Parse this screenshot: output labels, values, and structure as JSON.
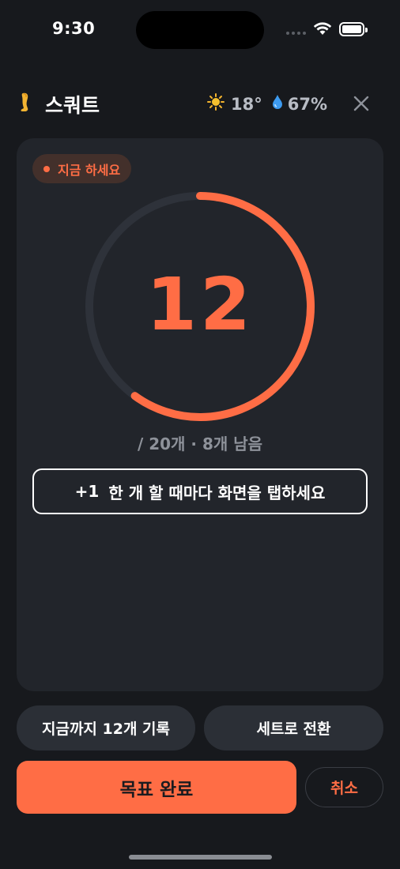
{
  "status_bar": {
    "time": "9:30"
  },
  "header": {
    "icon": "leg-emoji",
    "title": "스쿼트",
    "weather": {
      "icon": "sun-icon",
      "temperature": "18°",
      "humidity_icon": "droplet-icon",
      "humidity": "67%"
    },
    "close_icon": "close-icon"
  },
  "card": {
    "badge": "지금 하세요",
    "count": "12",
    "progress": {
      "current": 12,
      "goal": 20
    },
    "subtitle": "/ 20개 · 8개 남음",
    "tap_button": {
      "prefix": "+1",
      "label": "한 개 할 때마다 화면을 탭하세요"
    }
  },
  "actions": {
    "record_label": "지금까지 12개 기록",
    "switch_label": "세트로 전환",
    "complete_label": "목표 완료",
    "cancel_label": "취소"
  },
  "colors": {
    "accent": "#ff6d45",
    "background": "#17191d",
    "card": "#22252b",
    "ring_track": "#2e323a"
  }
}
